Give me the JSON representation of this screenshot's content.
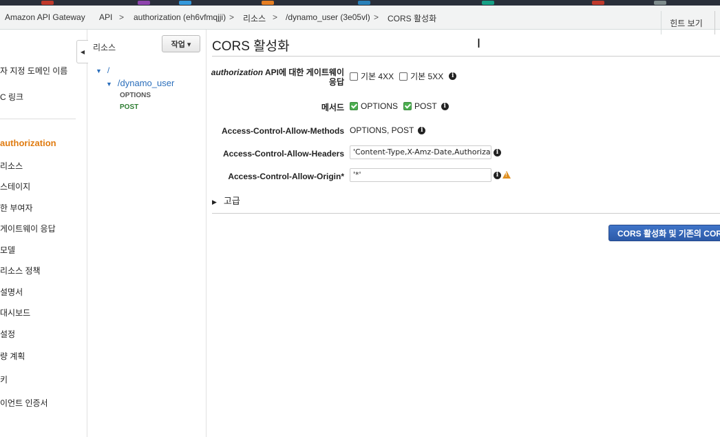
{
  "breadcrumb": {
    "service": "Amazon API Gateway",
    "items": [
      "API",
      "authorization (eh6vfmqjji)",
      "리소스",
      "/dynamo_user (3e05vl)",
      "CORS 활성화"
    ],
    "hint_label": "힌트 보기"
  },
  "leftnav": {
    "items": [
      {
        "label": "자 지정 도메인 이름"
      },
      {
        "label": "C 링크"
      },
      {
        "label": "authorization",
        "active": true
      },
      {
        "label": "리소스"
      },
      {
        "label": "스테이지"
      },
      {
        "label": "한 부여자"
      },
      {
        "label": "게이트웨이 응답"
      },
      {
        "label": "모델"
      },
      {
        "label": "리소스 정책"
      },
      {
        "label": "설명서"
      },
      {
        "label": "대시보드"
      },
      {
        "label": "설정"
      },
      {
        "label": "량 계획"
      },
      {
        "label": "키"
      },
      {
        "label": "이언트 인증서"
      }
    ]
  },
  "resources": {
    "title": "리소스",
    "action_label": "작업 ▾",
    "tree": {
      "root": "/",
      "child": "/dynamo_user",
      "methods": [
        "OPTIONS",
        "POST"
      ]
    }
  },
  "main": {
    "title": "CORS 활성화",
    "gateway_response_label_api": "authorization",
    "gateway_response_label_rest": " API에 대한 게이트웨이",
    "gateway_response_label_line2": "응답",
    "default_4xx": "기본 4XX",
    "default_5xx": "기본 5XX",
    "methods_label": "메서드",
    "method_options": "OPTIONS",
    "method_post": "POST",
    "allow_methods_label": "Access-Control-Allow-Methods",
    "allow_methods_value": "OPTIONS, POST",
    "allow_headers_label": "Access-Control-Allow-Headers",
    "allow_headers_value": "'Content-Type,X-Amz-Date,Authorization",
    "allow_origin_label": "Access-Control-Allow-Origin*",
    "allow_origin_value": "'*'",
    "advanced_label": "고급",
    "submit_label": "CORS 활성화 및 기존의 CORS"
  },
  "colors": {
    "accent_orange": "#e07b10",
    "link_blue": "#2a6ebb",
    "post_green": "#2e7d32",
    "primary_button": "#2c5aa8",
    "warning": "#e09020"
  }
}
